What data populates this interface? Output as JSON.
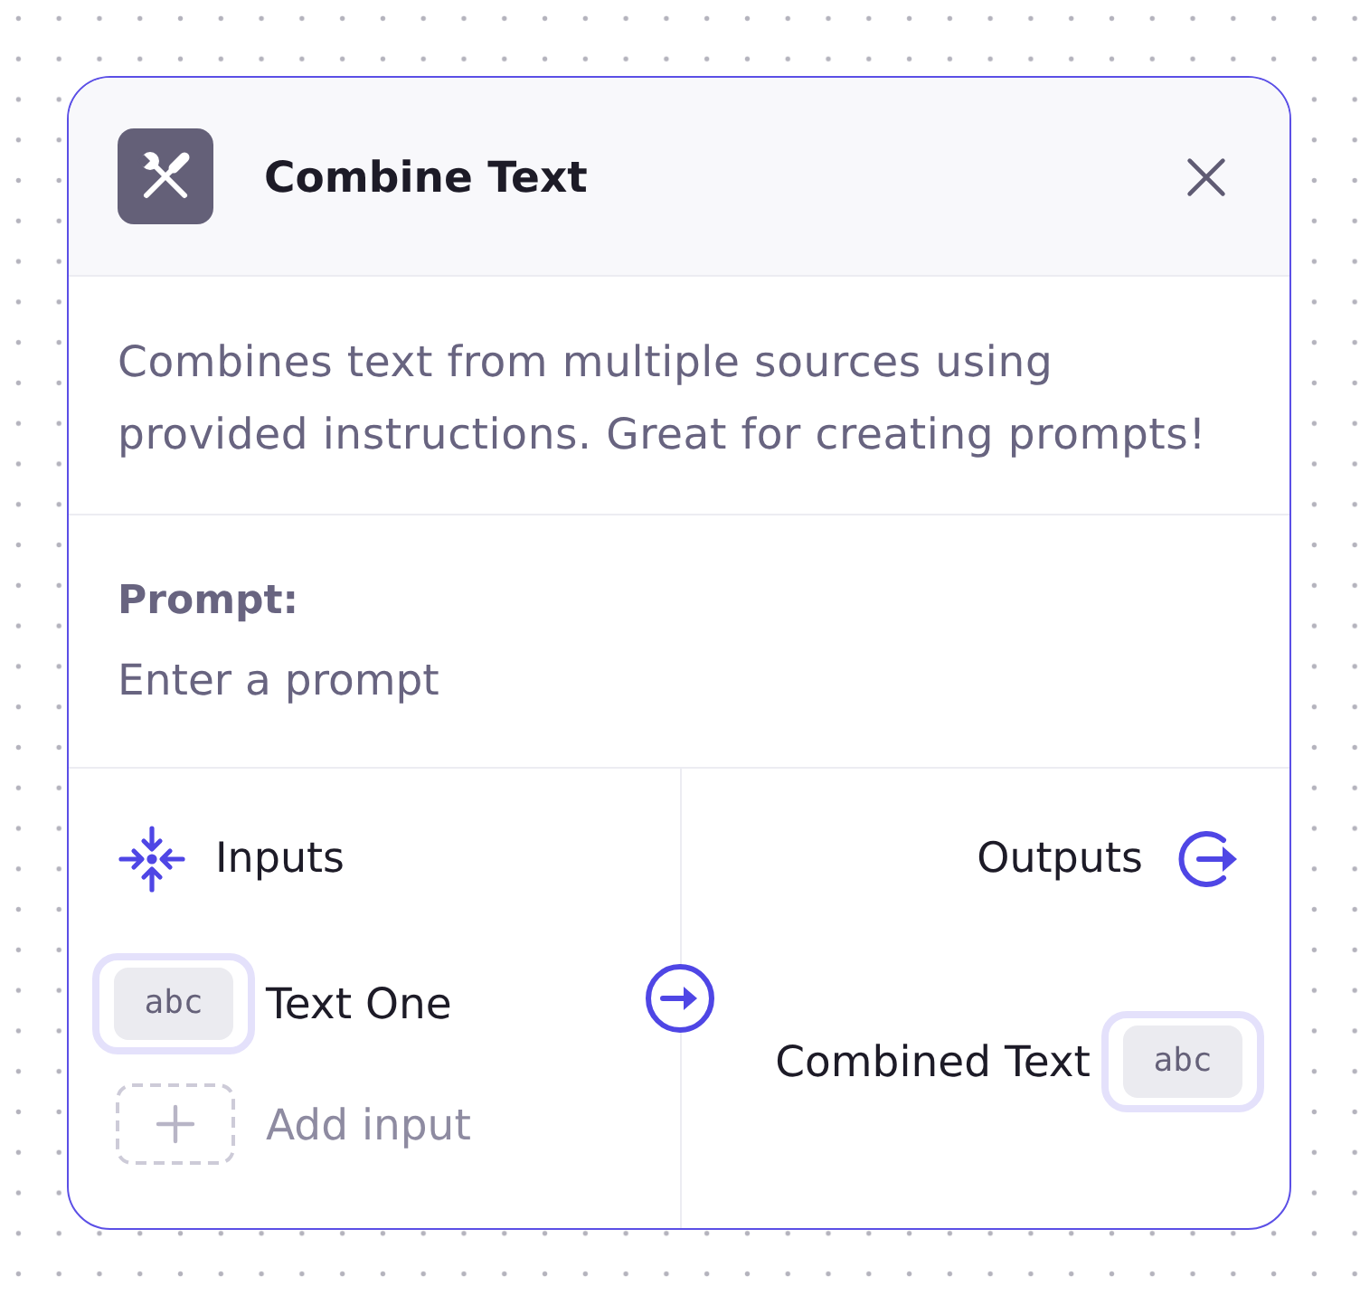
{
  "node": {
    "title": "Combine Text",
    "description": "Combines text from multiple sources using\nprovided instructions. Great for creating prompts!"
  },
  "prompt": {
    "label": "Prompt:",
    "placeholder": "Enter a prompt"
  },
  "inputs": {
    "heading": "Inputs",
    "items": [
      {
        "label": "Text One",
        "type_badge": "abc"
      }
    ],
    "add_label": "Add input"
  },
  "outputs": {
    "heading": "Outputs",
    "items": [
      {
        "label": "Combined Text",
        "type_badge": "abc"
      }
    ]
  }
}
